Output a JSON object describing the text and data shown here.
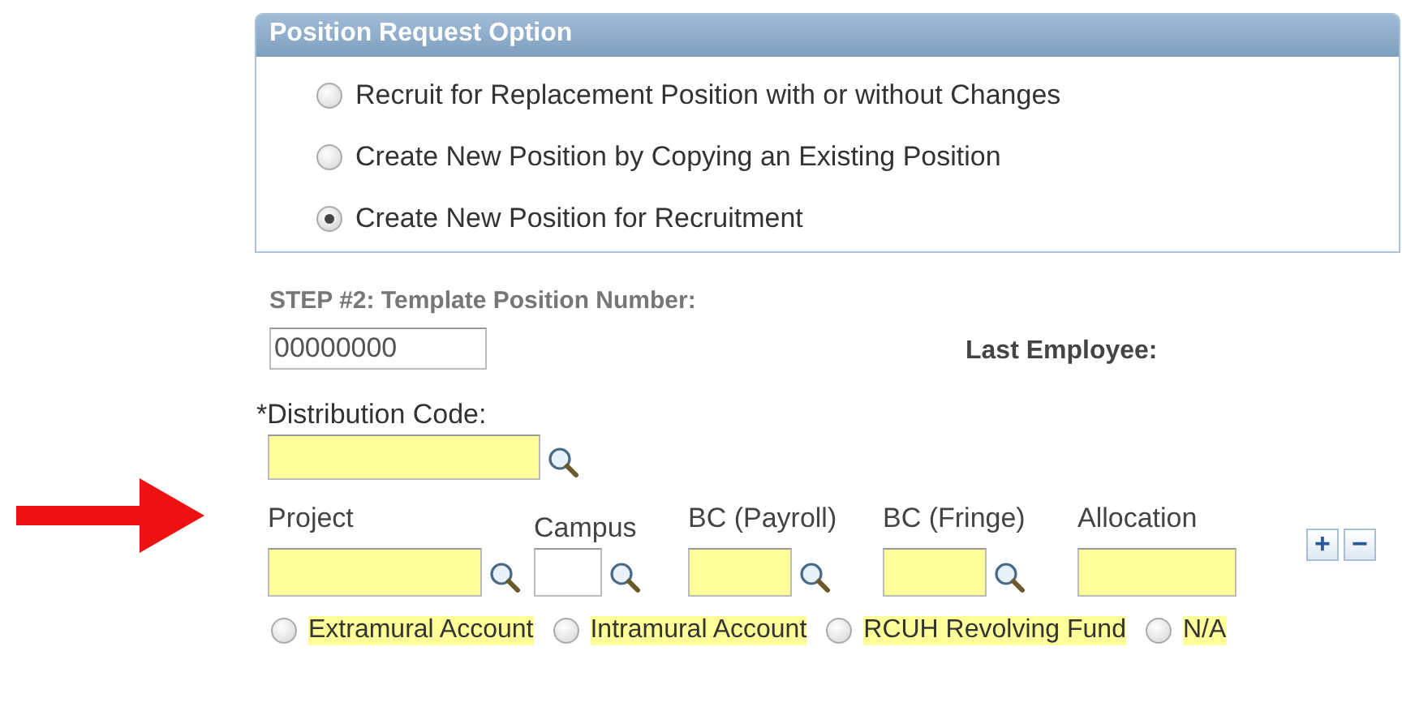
{
  "position_request": {
    "title": "Position Request Option",
    "options": [
      {
        "label": "Recruit for Replacement Position with or without Changes",
        "selected": false
      },
      {
        "label": "Create New Position by Copying an Existing Position",
        "selected": false
      },
      {
        "label": "Create New Position for Recruitment",
        "selected": true
      }
    ]
  },
  "template_position": {
    "label": "STEP #2: Template Position Number:",
    "value": "00000000"
  },
  "last_employee": {
    "label": "Last Employee:"
  },
  "distribution_code": {
    "label": "*Distribution Code:"
  },
  "distribution_fields": [
    {
      "label": "Project",
      "highlighted": true,
      "lookup": true
    },
    {
      "label": "Campus",
      "highlighted": false,
      "lookup": true
    },
    {
      "label": "BC (Payroll)",
      "highlighted": true,
      "lookup": true
    },
    {
      "label": "BC (Fringe)",
      "highlighted": true,
      "lookup": true
    },
    {
      "label": "Allocation",
      "highlighted": true,
      "lookup": false
    }
  ],
  "row_buttons": [
    "+",
    "−"
  ],
  "account_types": [
    {
      "label": "Extramural Account",
      "selected": false
    },
    {
      "label": "Intramural Account",
      "selected": false
    },
    {
      "label": "RCUH Revolving Fund",
      "selected": false
    },
    {
      "label": "N/A",
      "selected": false
    }
  ]
}
